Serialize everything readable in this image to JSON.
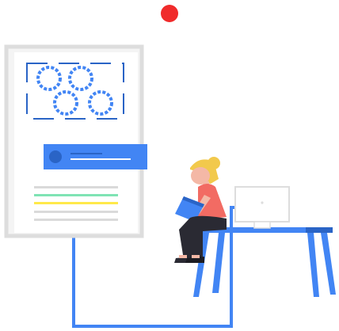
{
  "colors": {
    "primary_blue": "#4285f4",
    "dark_blue": "#2a64c6",
    "recording_dot": "#f02b2b",
    "panel_border": "#dddddd",
    "panel_fill": "#f4f4f4",
    "green_line": "#7fe3b4",
    "yellow_line": "#ffe94a",
    "gray_line": "#dadada",
    "shirt": "#f26b63",
    "hair": "#f2c94c",
    "skin": "#f4b8a6",
    "pants": "#2a2a33"
  },
  "icons": {
    "status_dot": "recording-dot-icon",
    "gears": "gear-icon",
    "avatar": "avatar-icon"
  }
}
